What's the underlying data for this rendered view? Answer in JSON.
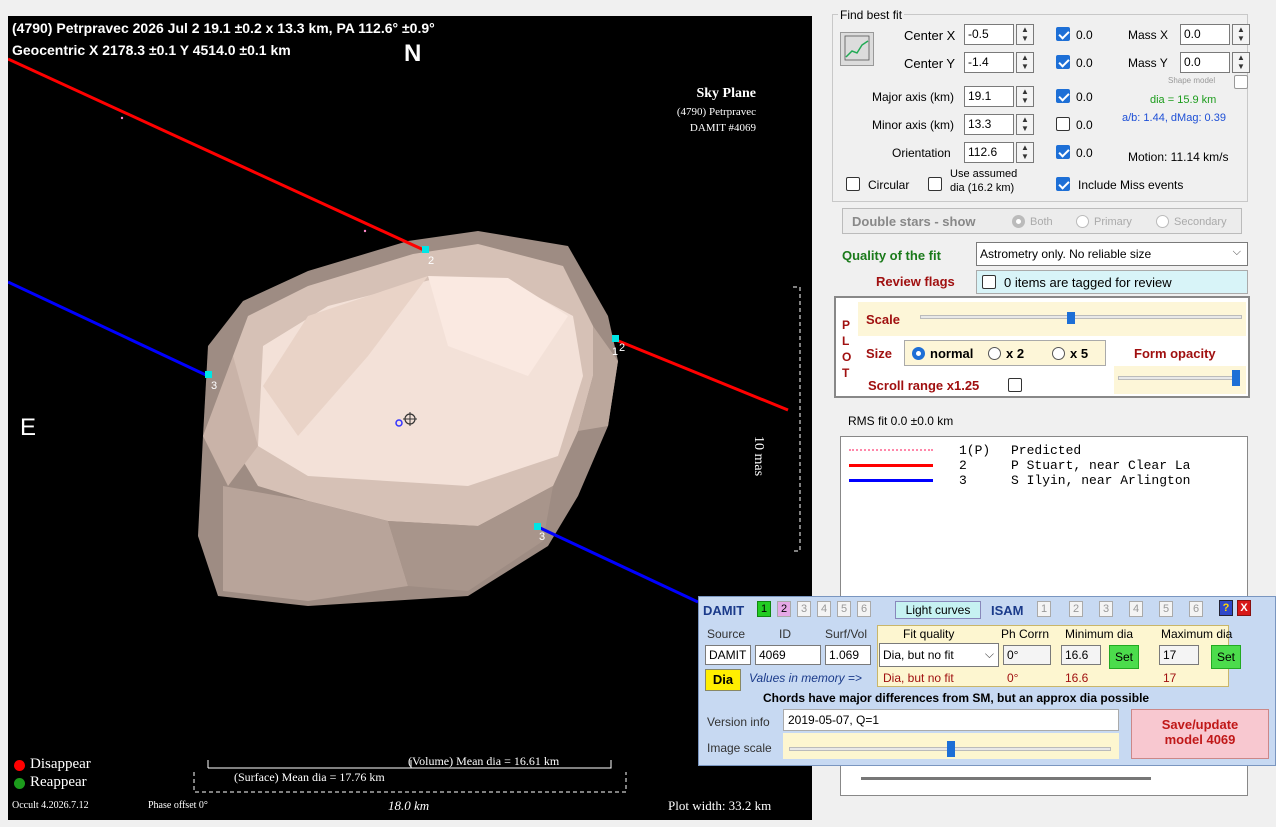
{
  "plot": {
    "title_line1": "(4790) Petrpravec  2026 Jul 2  19.1 ±0.2 x 13.3 km, PA 112.6° ±0.9°",
    "title_line2": "Geocentric  X  2178.3 ±0.1  Y 4514.0 ±0.1 km",
    "north": "N",
    "east": "E",
    "sky_plane": "Sky Plane",
    "object": "(4790) Petrpravec",
    "damit_ref": "DAMIT #4069",
    "scale_label": "10 mas",
    "volume_dia": "(Volume) Mean dia = 16.61 km",
    "surface_dia": "(Surface) Mean dia = 17.76 km",
    "scale_km": "18.0 km",
    "disappear": "Disappear",
    "reappear": "Reappear",
    "version": "Occult 4.2026.7.12",
    "phase_offset": "Phase offset 0°",
    "plot_width": "Plot width: 33.2 km",
    "chord_labels": [
      "2",
      "3",
      "1",
      "2",
      "3"
    ]
  },
  "fit": {
    "group_title": "Find best fit",
    "center_x_label": "Center X",
    "center_x": "-0.5",
    "center_x_err": "0.0",
    "center_y_label": "Center Y",
    "center_y": "-1.4",
    "center_y_err": "0.0",
    "major_label": "Major axis (km)",
    "major": "19.1",
    "major_err": "0.0",
    "minor_label": "Minor axis (km)",
    "minor": "13.3",
    "minor_err": "0.0",
    "orient_label": "Orientation",
    "orient": "112.6",
    "orient_err": "0.0",
    "mass_x_label": "Mass X",
    "mass_x": "0.0",
    "mass_y_label": "Mass Y",
    "mass_y": "0.0",
    "shape_model": "Shape model",
    "dia": "dia = 15.9 km",
    "ab": "a/b: 1.44, dMag: 0.39",
    "motion": "Motion: 11.14 km/s",
    "circular": "Circular",
    "use_assumed": "Use assumed",
    "use_assumed2": "dia (16.2 km)",
    "include_miss": "Include Miss events"
  },
  "double": {
    "title": "Double stars - show",
    "both": "Both",
    "primary": "Primary",
    "secondary": "Secondary"
  },
  "quality": {
    "label": "Quality of the fit",
    "value": "Astrometry only. No reliable size",
    "review_label": "Review flags",
    "review_value": "0 items are tagged for review"
  },
  "plotctl": {
    "vertical": [
      "P",
      "L",
      "O",
      "T"
    ],
    "scale": "Scale",
    "scale_level": 0.47,
    "size": "Size",
    "normal": "normal",
    "x2": "x 2",
    "x5": "x 5",
    "form_opacity": "Form opacity",
    "opacity_level": 0.97,
    "scroll": "Scroll range x1.25"
  },
  "rms": "RMS fit 0.0 ±0.0 km",
  "observers": [
    {
      "num": "1(P)",
      "name": "Predicted",
      "color": "#ff8888"
    },
    {
      "num": "2",
      "name": "P Stuart, near Clear La",
      "color": "#ff0000"
    },
    {
      "num": "3",
      "name": "S Ilyin, near Arlington",
      "color": "#0000ff"
    }
  ],
  "damit": {
    "label": "DAMIT",
    "tabs": [
      "1",
      "2",
      "3",
      "4",
      "5",
      "6"
    ],
    "light_curves": "Light curves",
    "isam": "ISAM",
    "isam_tabs": [
      "1",
      "2",
      "3",
      "4",
      "5",
      "6"
    ],
    "help": "?",
    "close": "X",
    "h_source": "Source",
    "h_id": "ID",
    "h_surf": "Surf/Vol",
    "h_fit": "Fit quality",
    "h_ph": "Ph Corrn",
    "h_min": "Minimum dia",
    "h_max": "Maximum dia",
    "source": "DAMIT",
    "id": "4069",
    "surf": "1.069",
    "fit_q": "Dia, but no fit",
    "ph": "0°",
    "min": "16.6",
    "max": "17",
    "set": "Set",
    "dia_btn": "Dia",
    "values_mem": "Values in memory =>",
    "mem_fit": "Dia, but no fit",
    "mem_ph": "0°",
    "mem_min": "16.6",
    "mem_max": "17",
    "chords_note": "Chords have major differences from SM, but an approx dia possible",
    "version_label": "Version info",
    "version_val": "2019-05-07, Q=1",
    "image_scale": "Image scale",
    "image_scale_level": 0.5,
    "save": "Save/update",
    "save2": "model 4069"
  }
}
